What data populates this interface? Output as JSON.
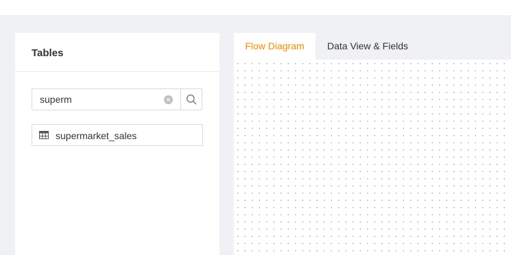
{
  "left_panel": {
    "title": "Tables",
    "search": {
      "value": "superm",
      "placeholder": ""
    },
    "tables": [
      {
        "label": "supermarket_sales",
        "icon": "table-icon"
      }
    ]
  },
  "tabs": [
    {
      "label": "Flow Diagram",
      "active": true
    },
    {
      "label": "Data View & Fields",
      "active": false
    }
  ],
  "colors": {
    "accent": "#f08a00",
    "workspace_bg": "#f0f1f5"
  }
}
